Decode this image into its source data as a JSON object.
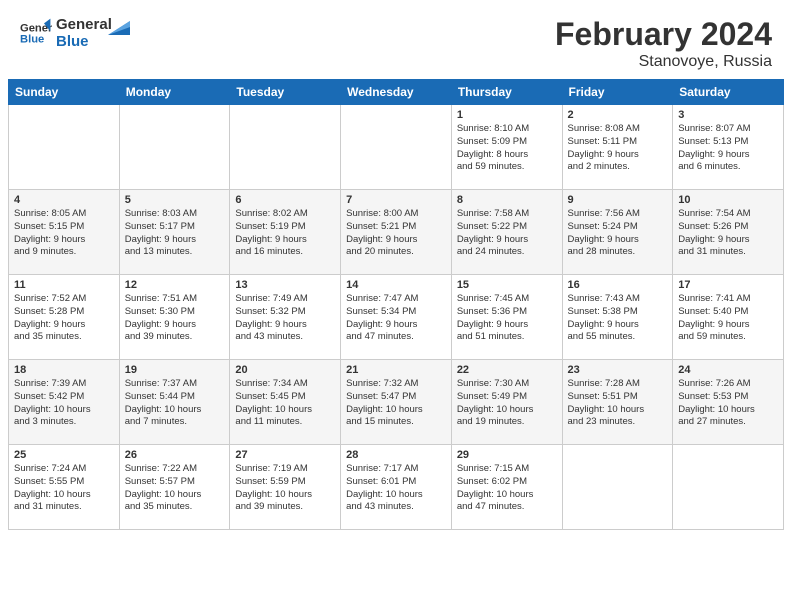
{
  "header": {
    "logo_text_general": "General",
    "logo_text_blue": "Blue",
    "month_year": "February 2024",
    "location": "Stanovoye, Russia"
  },
  "calendar": {
    "headers": [
      "Sunday",
      "Monday",
      "Tuesday",
      "Wednesday",
      "Thursday",
      "Friday",
      "Saturday"
    ],
    "rows": [
      [
        {
          "day": "",
          "content": ""
        },
        {
          "day": "",
          "content": ""
        },
        {
          "day": "",
          "content": ""
        },
        {
          "day": "",
          "content": ""
        },
        {
          "day": "1",
          "content": "Sunrise: 8:10 AM\nSunset: 5:09 PM\nDaylight: 8 hours\nand 59 minutes."
        },
        {
          "day": "2",
          "content": "Sunrise: 8:08 AM\nSunset: 5:11 PM\nDaylight: 9 hours\nand 2 minutes."
        },
        {
          "day": "3",
          "content": "Sunrise: 8:07 AM\nSunset: 5:13 PM\nDaylight: 9 hours\nand 6 minutes."
        }
      ],
      [
        {
          "day": "4",
          "content": "Sunrise: 8:05 AM\nSunset: 5:15 PM\nDaylight: 9 hours\nand 9 minutes."
        },
        {
          "day": "5",
          "content": "Sunrise: 8:03 AM\nSunset: 5:17 PM\nDaylight: 9 hours\nand 13 minutes."
        },
        {
          "day": "6",
          "content": "Sunrise: 8:02 AM\nSunset: 5:19 PM\nDaylight: 9 hours\nand 16 minutes."
        },
        {
          "day": "7",
          "content": "Sunrise: 8:00 AM\nSunset: 5:21 PM\nDaylight: 9 hours\nand 20 minutes."
        },
        {
          "day": "8",
          "content": "Sunrise: 7:58 AM\nSunset: 5:22 PM\nDaylight: 9 hours\nand 24 minutes."
        },
        {
          "day": "9",
          "content": "Sunrise: 7:56 AM\nSunset: 5:24 PM\nDaylight: 9 hours\nand 28 minutes."
        },
        {
          "day": "10",
          "content": "Sunrise: 7:54 AM\nSunset: 5:26 PM\nDaylight: 9 hours\nand 31 minutes."
        }
      ],
      [
        {
          "day": "11",
          "content": "Sunrise: 7:52 AM\nSunset: 5:28 PM\nDaylight: 9 hours\nand 35 minutes."
        },
        {
          "day": "12",
          "content": "Sunrise: 7:51 AM\nSunset: 5:30 PM\nDaylight: 9 hours\nand 39 minutes."
        },
        {
          "day": "13",
          "content": "Sunrise: 7:49 AM\nSunset: 5:32 PM\nDaylight: 9 hours\nand 43 minutes."
        },
        {
          "day": "14",
          "content": "Sunrise: 7:47 AM\nSunset: 5:34 PM\nDaylight: 9 hours\nand 47 minutes."
        },
        {
          "day": "15",
          "content": "Sunrise: 7:45 AM\nSunset: 5:36 PM\nDaylight: 9 hours\nand 51 minutes."
        },
        {
          "day": "16",
          "content": "Sunrise: 7:43 AM\nSunset: 5:38 PM\nDaylight: 9 hours\nand 55 minutes."
        },
        {
          "day": "17",
          "content": "Sunrise: 7:41 AM\nSunset: 5:40 PM\nDaylight: 9 hours\nand 59 minutes."
        }
      ],
      [
        {
          "day": "18",
          "content": "Sunrise: 7:39 AM\nSunset: 5:42 PM\nDaylight: 10 hours\nand 3 minutes."
        },
        {
          "day": "19",
          "content": "Sunrise: 7:37 AM\nSunset: 5:44 PM\nDaylight: 10 hours\nand 7 minutes."
        },
        {
          "day": "20",
          "content": "Sunrise: 7:34 AM\nSunset: 5:45 PM\nDaylight: 10 hours\nand 11 minutes."
        },
        {
          "day": "21",
          "content": "Sunrise: 7:32 AM\nSunset: 5:47 PM\nDaylight: 10 hours\nand 15 minutes."
        },
        {
          "day": "22",
          "content": "Sunrise: 7:30 AM\nSunset: 5:49 PM\nDaylight: 10 hours\nand 19 minutes."
        },
        {
          "day": "23",
          "content": "Sunrise: 7:28 AM\nSunset: 5:51 PM\nDaylight: 10 hours\nand 23 minutes."
        },
        {
          "day": "24",
          "content": "Sunrise: 7:26 AM\nSunset: 5:53 PM\nDaylight: 10 hours\nand 27 minutes."
        }
      ],
      [
        {
          "day": "25",
          "content": "Sunrise: 7:24 AM\nSunset: 5:55 PM\nDaylight: 10 hours\nand 31 minutes."
        },
        {
          "day": "26",
          "content": "Sunrise: 7:22 AM\nSunset: 5:57 PM\nDaylight: 10 hours\nand 35 minutes."
        },
        {
          "day": "27",
          "content": "Sunrise: 7:19 AM\nSunset: 5:59 PM\nDaylight: 10 hours\nand 39 minutes."
        },
        {
          "day": "28",
          "content": "Sunrise: 7:17 AM\nSunset: 6:01 PM\nDaylight: 10 hours\nand 43 minutes."
        },
        {
          "day": "29",
          "content": "Sunrise: 7:15 AM\nSunset: 6:02 PM\nDaylight: 10 hours\nand 47 minutes."
        },
        {
          "day": "",
          "content": ""
        },
        {
          "day": "",
          "content": ""
        }
      ]
    ]
  }
}
